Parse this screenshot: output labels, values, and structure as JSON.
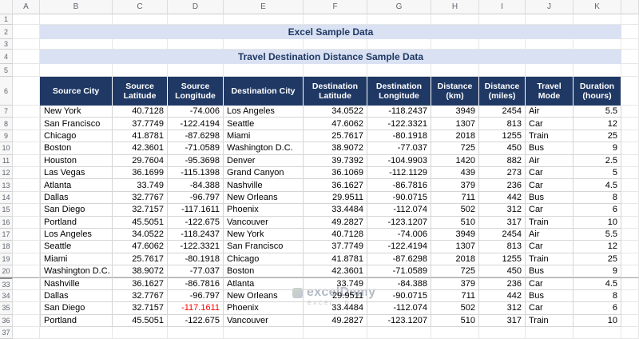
{
  "sheet": {
    "column_letters": [
      "A",
      "B",
      "C",
      "D",
      "E",
      "F",
      "G",
      "H",
      "I",
      "J",
      "K"
    ],
    "row_labels": {
      "r1": "1",
      "r2": "2",
      "r3": "3",
      "r4": "4",
      "r5": "5",
      "r6": "6",
      "r37": "37"
    },
    "titles": {
      "main": "Excel Sample Data",
      "sub": "Travel Destination Distance Sample Data"
    },
    "headers": [
      "Source City",
      "Source Latitude",
      "Source Longitude",
      "Destination City",
      "Destination Latitude",
      "Destination Longitude",
      "Distance (km)",
      "Distance (miles)",
      "Travel Mode",
      "Duration (hours)"
    ],
    "rows": [
      {
        "n": "7",
        "cells": [
          "New York",
          "40.7128",
          "-74.006",
          "Los Angeles",
          "34.0522",
          "-118.2437",
          "3949",
          "2454",
          "Air",
          "5.5"
        ]
      },
      {
        "n": "8",
        "cells": [
          "San Francisco",
          "37.7749",
          "-122.4194",
          "Seattle",
          "47.6062",
          "-122.3321",
          "1307",
          "813",
          "Car",
          "12"
        ]
      },
      {
        "n": "9",
        "cells": [
          "Chicago",
          "41.8781",
          "-87.6298",
          "Miami",
          "25.7617",
          "-80.1918",
          "2018",
          "1255",
          "Train",
          "25"
        ]
      },
      {
        "n": "10",
        "cells": [
          "Boston",
          "42.3601",
          "-71.0589",
          "Washington D.C.",
          "38.9072",
          "-77.037",
          "725",
          "450",
          "Bus",
          "9"
        ]
      },
      {
        "n": "11",
        "cells": [
          "Houston",
          "29.7604",
          "-95.3698",
          "Denver",
          "39.7392",
          "-104.9903",
          "1420",
          "882",
          "Air",
          "2.5"
        ]
      },
      {
        "n": "12",
        "cells": [
          "Las Vegas",
          "36.1699",
          "-115.1398",
          "Grand Canyon",
          "36.1069",
          "-112.1129",
          "439",
          "273",
          "Car",
          "5"
        ]
      },
      {
        "n": "13",
        "cells": [
          "Atlanta",
          "33.749",
          "-84.388",
          "Nashville",
          "36.1627",
          "-86.7816",
          "379",
          "236",
          "Car",
          "4.5"
        ]
      },
      {
        "n": "14",
        "cells": [
          "Dallas",
          "32.7767",
          "-96.797",
          "New Orleans",
          "29.9511",
          "-90.0715",
          "711",
          "442",
          "Bus",
          "8"
        ]
      },
      {
        "n": "15",
        "cells": [
          "San Diego",
          "32.7157",
          "-117.1611",
          "Phoenix",
          "33.4484",
          "-112.074",
          "502",
          "312",
          "Car",
          "6"
        ]
      },
      {
        "n": "16",
        "cells": [
          "Portland",
          "45.5051",
          "-122.675",
          "Vancouver",
          "49.2827",
          "-123.1207",
          "510",
          "317",
          "Train",
          "10"
        ]
      },
      {
        "n": "17",
        "cells": [
          "Los Angeles",
          "34.0522",
          "-118.2437",
          "New York",
          "40.7128",
          "-74.006",
          "3949",
          "2454",
          "Air",
          "5.5"
        ]
      },
      {
        "n": "18",
        "cells": [
          "Seattle",
          "47.6062",
          "-122.3321",
          "San Francisco",
          "37.7749",
          "-122.4194",
          "1307",
          "813",
          "Car",
          "12"
        ]
      },
      {
        "n": "19",
        "cells": [
          "Miami",
          "25.7617",
          "-80.1918",
          "Chicago",
          "41.8781",
          "-87.6298",
          "2018",
          "1255",
          "Train",
          "25"
        ]
      },
      {
        "n": "20",
        "cells": [
          "Washington D.C.",
          "38.9072",
          "-77.037",
          "Boston",
          "42.3601",
          "-71.0589",
          "725",
          "450",
          "Bus",
          "9"
        ]
      },
      {
        "n": "33",
        "break": true,
        "cells": [
          "Nashville",
          "36.1627",
          "-86.7816",
          "Atlanta",
          "33.749",
          "-84.388",
          "379",
          "236",
          "Car",
          "4.5"
        ]
      },
      {
        "n": "34",
        "cells": [
          "Dallas",
          "32.7767",
          "-96.797",
          "New Orleans",
          "29.9511",
          "-90.0715",
          "711",
          "442",
          "Bus",
          "8"
        ]
      },
      {
        "n": "35",
        "red": [
          2
        ],
        "cells": [
          "San Diego",
          "32.7157",
          "-117.1611",
          "Phoenix",
          "33.4484",
          "-112.074",
          "502",
          "312",
          "Car",
          "6"
        ]
      },
      {
        "n": "36",
        "cells": [
          "Portland",
          "45.5051",
          "-122.675",
          "Vancouver",
          "49.2827",
          "-123.1207",
          "510",
          "317",
          "Train",
          "10"
        ]
      }
    ]
  },
  "watermark": {
    "line1": "excelDemy",
    "line2": "EXCEL · D"
  },
  "colors": {
    "title_band": "#D9E1F2",
    "navy": "#1F3864",
    "header_text": "#FFFFFF",
    "negative_red": "#FF0000",
    "gridline": "#E7E7E7",
    "table_border": "#D5D5D5"
  }
}
